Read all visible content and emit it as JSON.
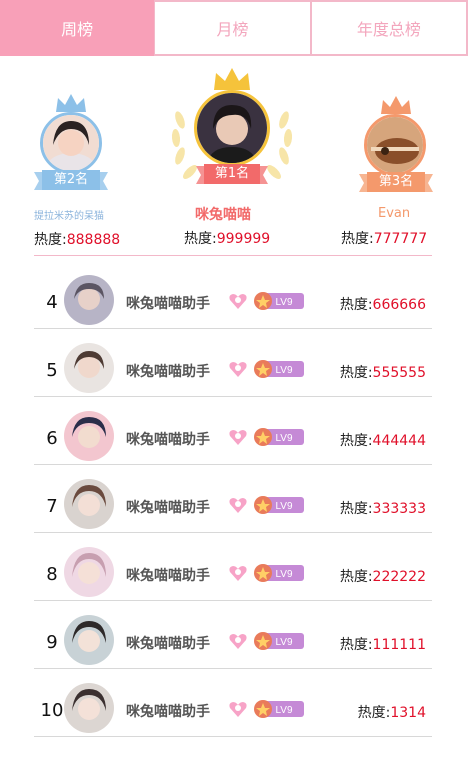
{
  "tabs": [
    {
      "label": "周榜",
      "active": true
    },
    {
      "label": "月榜",
      "active": false
    },
    {
      "label": "年度总榜",
      "active": false
    }
  ],
  "podium": {
    "first": {
      "rank_label": "第1名",
      "name": "咪兔喵喵",
      "heat_label": "热度:",
      "heat_value": "999999",
      "crown_color": "#f5c33b",
      "ribbon_color": "#f26a6a"
    },
    "second": {
      "rank_label": "第2名",
      "name": "提拉米苏的呆猫",
      "heat_label": "热度:",
      "heat_value": "888888",
      "crown_color": "#8cc0e8",
      "ribbon_color": "#8cc0e8"
    },
    "third": {
      "rank_label": "第3名",
      "name": "Evan",
      "heat_label": "热度:",
      "heat_value": "777777",
      "crown_color": "#f4996c",
      "ribbon_color": "#f4996c"
    }
  },
  "list": [
    {
      "rank": "4",
      "name": "咪兔喵喵助手",
      "badge": "LV9",
      "heat_label": "热度:",
      "heat_value": "666666"
    },
    {
      "rank": "5",
      "name": "咪兔喵喵助手",
      "badge": "LV9",
      "heat_label": "热度:",
      "heat_value": "555555"
    },
    {
      "rank": "6",
      "name": "咪兔喵喵助手",
      "badge": "LV9",
      "heat_label": "热度:",
      "heat_value": "444444"
    },
    {
      "rank": "7",
      "name": "咪兔喵喵助手",
      "badge": "LV9",
      "heat_label": "热度:",
      "heat_value": "333333"
    },
    {
      "rank": "8",
      "name": "咪兔喵喵助手",
      "badge": "LV9",
      "heat_label": "热度:",
      "heat_value": "222222"
    },
    {
      "rank": "9",
      "name": "咪兔喵喵助手",
      "badge": "LV9",
      "heat_label": "热度:",
      "heat_value": "111111"
    },
    {
      "rank": "10",
      "name": "咪兔喵喵助手",
      "badge": "LV9",
      "heat_label": "热度:",
      "heat_value": "1314"
    }
  ],
  "colors": {
    "accent_pink": "#f8a0b8",
    "heat_red": "#e0102a"
  }
}
